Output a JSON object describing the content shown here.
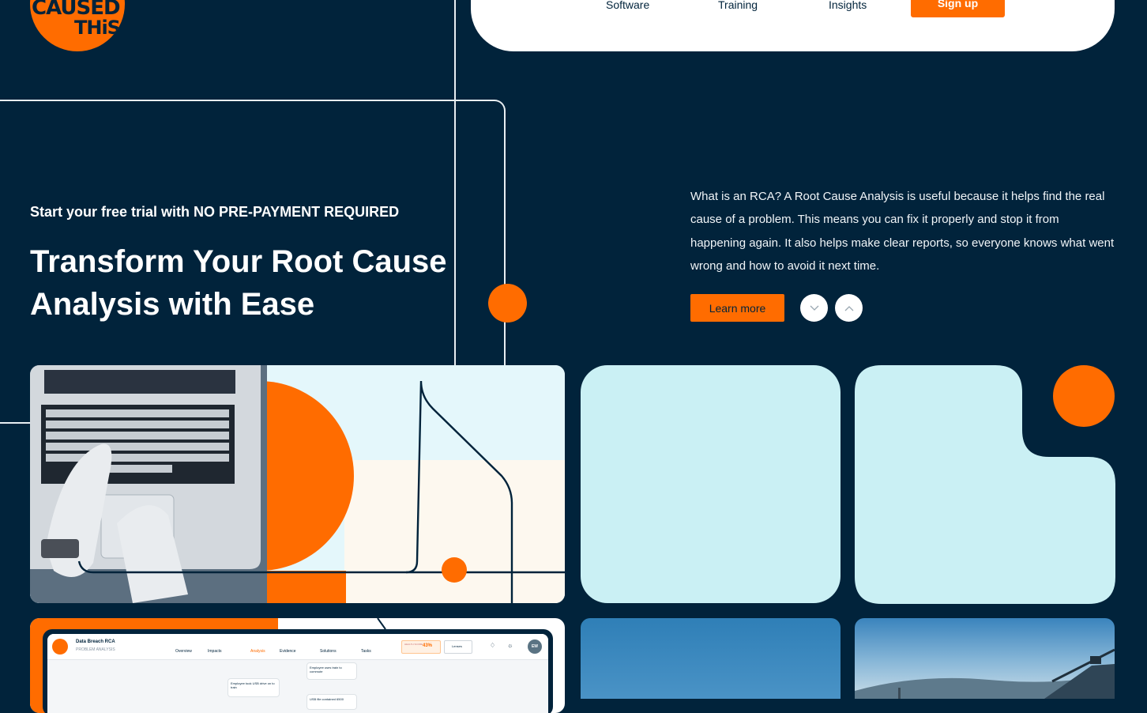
{
  "logo": {
    "line1": "CAUSED",
    "line2": "THiS"
  },
  "nav": {
    "items": [
      "Software",
      "Training",
      "Insights"
    ],
    "signup_label": "Sign up"
  },
  "hero": {
    "trial_text": "Start your free trial with NO PRE-PAYMENT REQUIRED",
    "headline": "Transform Your Root Cause Analysis with Ease",
    "description": "What is an RCA? A Root Cause Analysis is useful because it helps find the real cause of a problem. This means you can fix it properly and stop it from happening again. It also helps make clear reports, so everyone knows what went wrong and how to avoid it next time.",
    "learn_more_label": "Learn more",
    "down_icon": "chevron-down-icon",
    "up_icon": "chevron-up-icon"
  },
  "app_preview": {
    "title": "Data Breach RCA",
    "subtitle": "PROBLEM ANALYSIS",
    "tabs": [
      {
        "label": "Overview",
        "badge": ""
      },
      {
        "label": "Impacts",
        "badge": "2"
      },
      {
        "label": "Analysis",
        "badge": ""
      },
      {
        "label": "Evidence",
        "badge": "4"
      },
      {
        "label": "Solutions",
        "badge": "4"
      },
      {
        "label": "Tasks",
        "badge": "2"
      }
    ],
    "health_label": "HEALTH SCORE",
    "health_value": "43%",
    "lenses_label": "Lenses",
    "avatar": "EW",
    "nodes": [
      "Employee uses train to commute",
      "Employee took USB drive on to train",
      "USB file contained 6500"
    ]
  },
  "colors": {
    "navy": "#01233b",
    "orange": "#ff6c00",
    "teal": "#caf0f4",
    "white": "#ffffff"
  }
}
